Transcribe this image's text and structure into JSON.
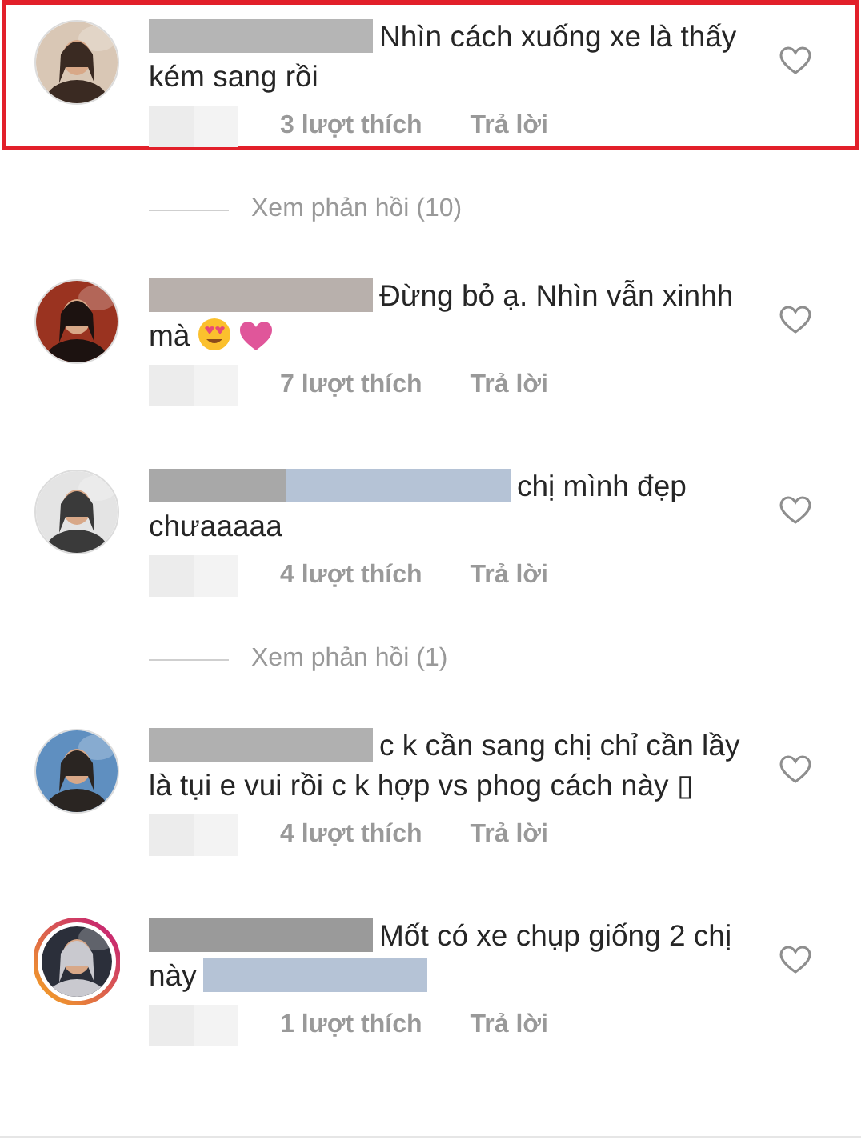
{
  "items": [
    {
      "kind": "comment",
      "highlighted": true,
      "avatar": {
        "story_ring": false
      },
      "segments": [
        {
          "kind": "redacted",
          "color": "#b5b5b5"
        },
        {
          "kind": "text",
          "text": "Nhìn cách xuống xe là thấy kém sang rồi"
        }
      ],
      "likes": "3 lượt thích",
      "reply": "Trả lời"
    },
    {
      "kind": "replies",
      "text": "Xem phản hồi (10)"
    },
    {
      "kind": "comment",
      "highlighted": false,
      "avatar": {
        "story_ring": false
      },
      "segments": [
        {
          "kind": "redacted",
          "color": "#b8b0ac"
        },
        {
          "kind": "text",
          "text": "Đừng bỏ ạ. Nhìn vẫn xinhh mà"
        },
        {
          "kind": "emoji_face"
        },
        {
          "kind": "emoji_heart"
        }
      ],
      "likes": "7 lượt thích",
      "reply": "Trả lời"
    },
    {
      "kind": "comment",
      "highlighted": false,
      "avatar": {
        "story_ring": false
      },
      "segments": [
        {
          "kind": "redacted",
          "color": "#a8a8a8"
        },
        {
          "kind": "redacted",
          "color": "#b5c3d6"
        },
        {
          "kind": "text",
          "text": "chị mình đẹp chưaaaaa"
        }
      ],
      "likes": "4 lượt thích",
      "reply": "Trả lời"
    },
    {
      "kind": "replies",
      "text": "Xem phản hồi (1)"
    },
    {
      "kind": "comment",
      "highlighted": false,
      "avatar": {
        "story_ring": false
      },
      "segments": [
        {
          "kind": "redacted",
          "color": "#b0b0b0"
        },
        {
          "kind": "text",
          "text": "c k cần sang chị chỉ cần lầy là tụi e vui rồi c k hợp vs phog cách này ▯"
        }
      ],
      "likes": "4 lượt thích",
      "reply": "Trả lời"
    },
    {
      "kind": "comment",
      "highlighted": false,
      "avatar": {
        "story_ring": true
      },
      "segments": [
        {
          "kind": "redacted",
          "color": "#9a9a9a"
        },
        {
          "kind": "text",
          "text": "Mốt có xe chụp giống 2 chị này"
        },
        {
          "kind": "redacted",
          "color": "#b5c3d6"
        }
      ],
      "likes": "1 lượt thích",
      "reply": "Trả lời"
    }
  ]
}
